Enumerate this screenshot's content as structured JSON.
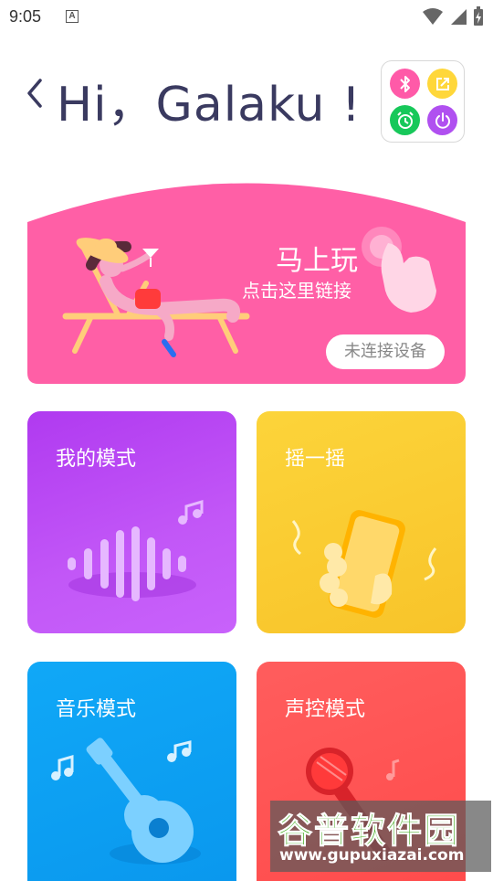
{
  "status_bar": {
    "time": "9:05",
    "notification_icon_letter": "A"
  },
  "header": {
    "greeting": "Hi，Galaku !"
  },
  "quick_actions": [
    {
      "icon": "bluetooth-icon",
      "color": "#ff5aa8"
    },
    {
      "icon": "share-icon",
      "color": "#ffd73a"
    },
    {
      "icon": "alarm-icon",
      "color": "#17c85a"
    },
    {
      "icon": "power-icon",
      "color": "#b050f0"
    }
  ],
  "banner": {
    "title": "马上玩",
    "subtitle": "点击这里链接",
    "status": "未连接设备",
    "color": "#ff5fa6"
  },
  "modes": [
    {
      "id": "mine",
      "label": "我的模式",
      "color": "#bb4cf6"
    },
    {
      "id": "shake",
      "label": "摇一摇",
      "color": "#fbcf33"
    },
    {
      "id": "music",
      "label": "音乐模式",
      "color": "#0fa4f5"
    },
    {
      "id": "voice",
      "label": "声控模式",
      "color": "#ff5555"
    }
  ],
  "watermark": {
    "title": "谷普软件园",
    "url": "www.gupuxiazai.com"
  }
}
